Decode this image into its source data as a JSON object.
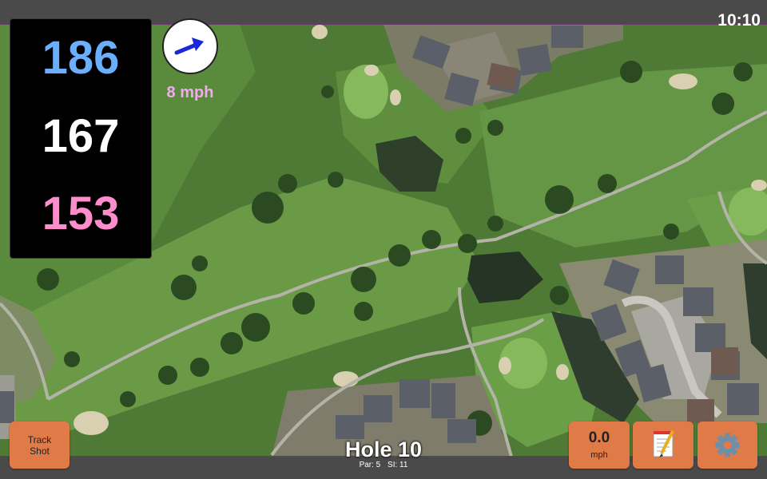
{
  "status_bar": {
    "time": "10:10"
  },
  "distances": {
    "back": "186",
    "middle": "167",
    "front": "153",
    "colors": {
      "back": "#6aaefc",
      "middle": "#ffffff",
      "front": "#ff8ccc"
    }
  },
  "wind": {
    "speed_label": "8 mph",
    "arrow_icon": "wind-direction-arrow-icon",
    "arrow_color": "#1a28d8",
    "label_color": "#f2aaf0"
  },
  "buttons": {
    "track_shot_line1": "Track",
    "track_shot_line2": "Shot",
    "speed_value": "0.0",
    "speed_unit": "mph",
    "notes_icon": "notepad-icon",
    "settings_icon": "gear-icon",
    "color": "#e07a47"
  },
  "hole": {
    "title": "Hole 10",
    "par": "Par: 5",
    "si": "SI: 11"
  }
}
